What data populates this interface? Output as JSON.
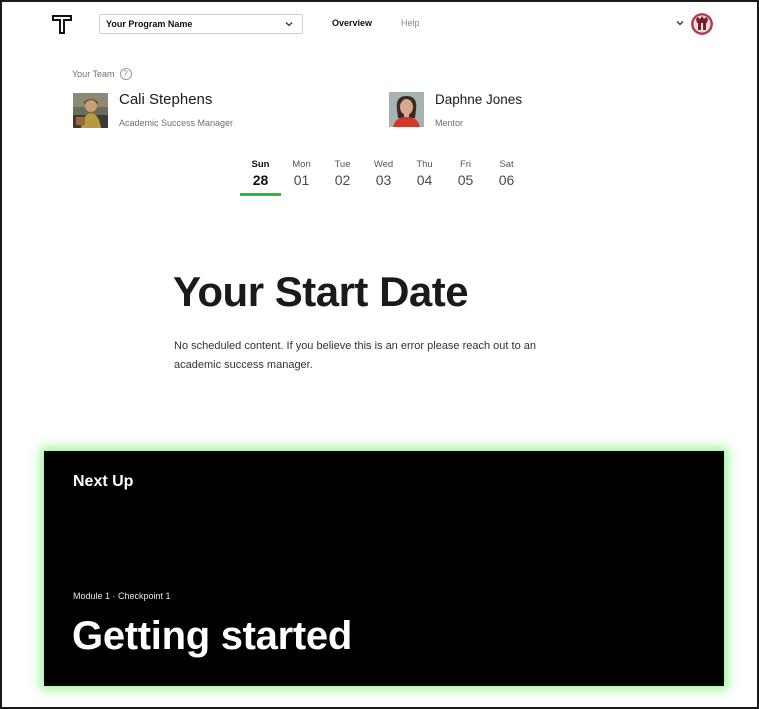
{
  "nav": {
    "program_select": "Your Program Name",
    "links": {
      "overview": "Overview",
      "help": "Help"
    }
  },
  "team": {
    "heading": "Your Team",
    "help_glyph": "?",
    "members": [
      {
        "name": "Cali Stephens",
        "role": "Academic Success Manager"
      },
      {
        "name": "Daphne Jones",
        "role": "Mentor"
      }
    ]
  },
  "calendar": {
    "days": [
      {
        "name": "Sun",
        "num": "28",
        "active": true
      },
      {
        "name": "Mon",
        "num": "01"
      },
      {
        "name": "Tue",
        "num": "02"
      },
      {
        "name": "Wed",
        "num": "03"
      },
      {
        "name": "Thu",
        "num": "04"
      },
      {
        "name": "Fri",
        "num": "05"
      },
      {
        "name": "Sat",
        "num": "06"
      }
    ]
  },
  "start": {
    "title": "Your Start Date",
    "body": "No scheduled content. If you believe this is an error please reach out to an academic success manager."
  },
  "next_up": {
    "label": "Next Up",
    "meta": "Module 1 · Checkpoint 1",
    "title": "Getting started"
  },
  "colors": {
    "accent_green": "#2bbd3a",
    "card_glow": "#78f06e",
    "card_bg": "#000000"
  },
  "icons": [
    "logo-icon",
    "chevron-down-icon",
    "help-icon",
    "user-avatar"
  ]
}
